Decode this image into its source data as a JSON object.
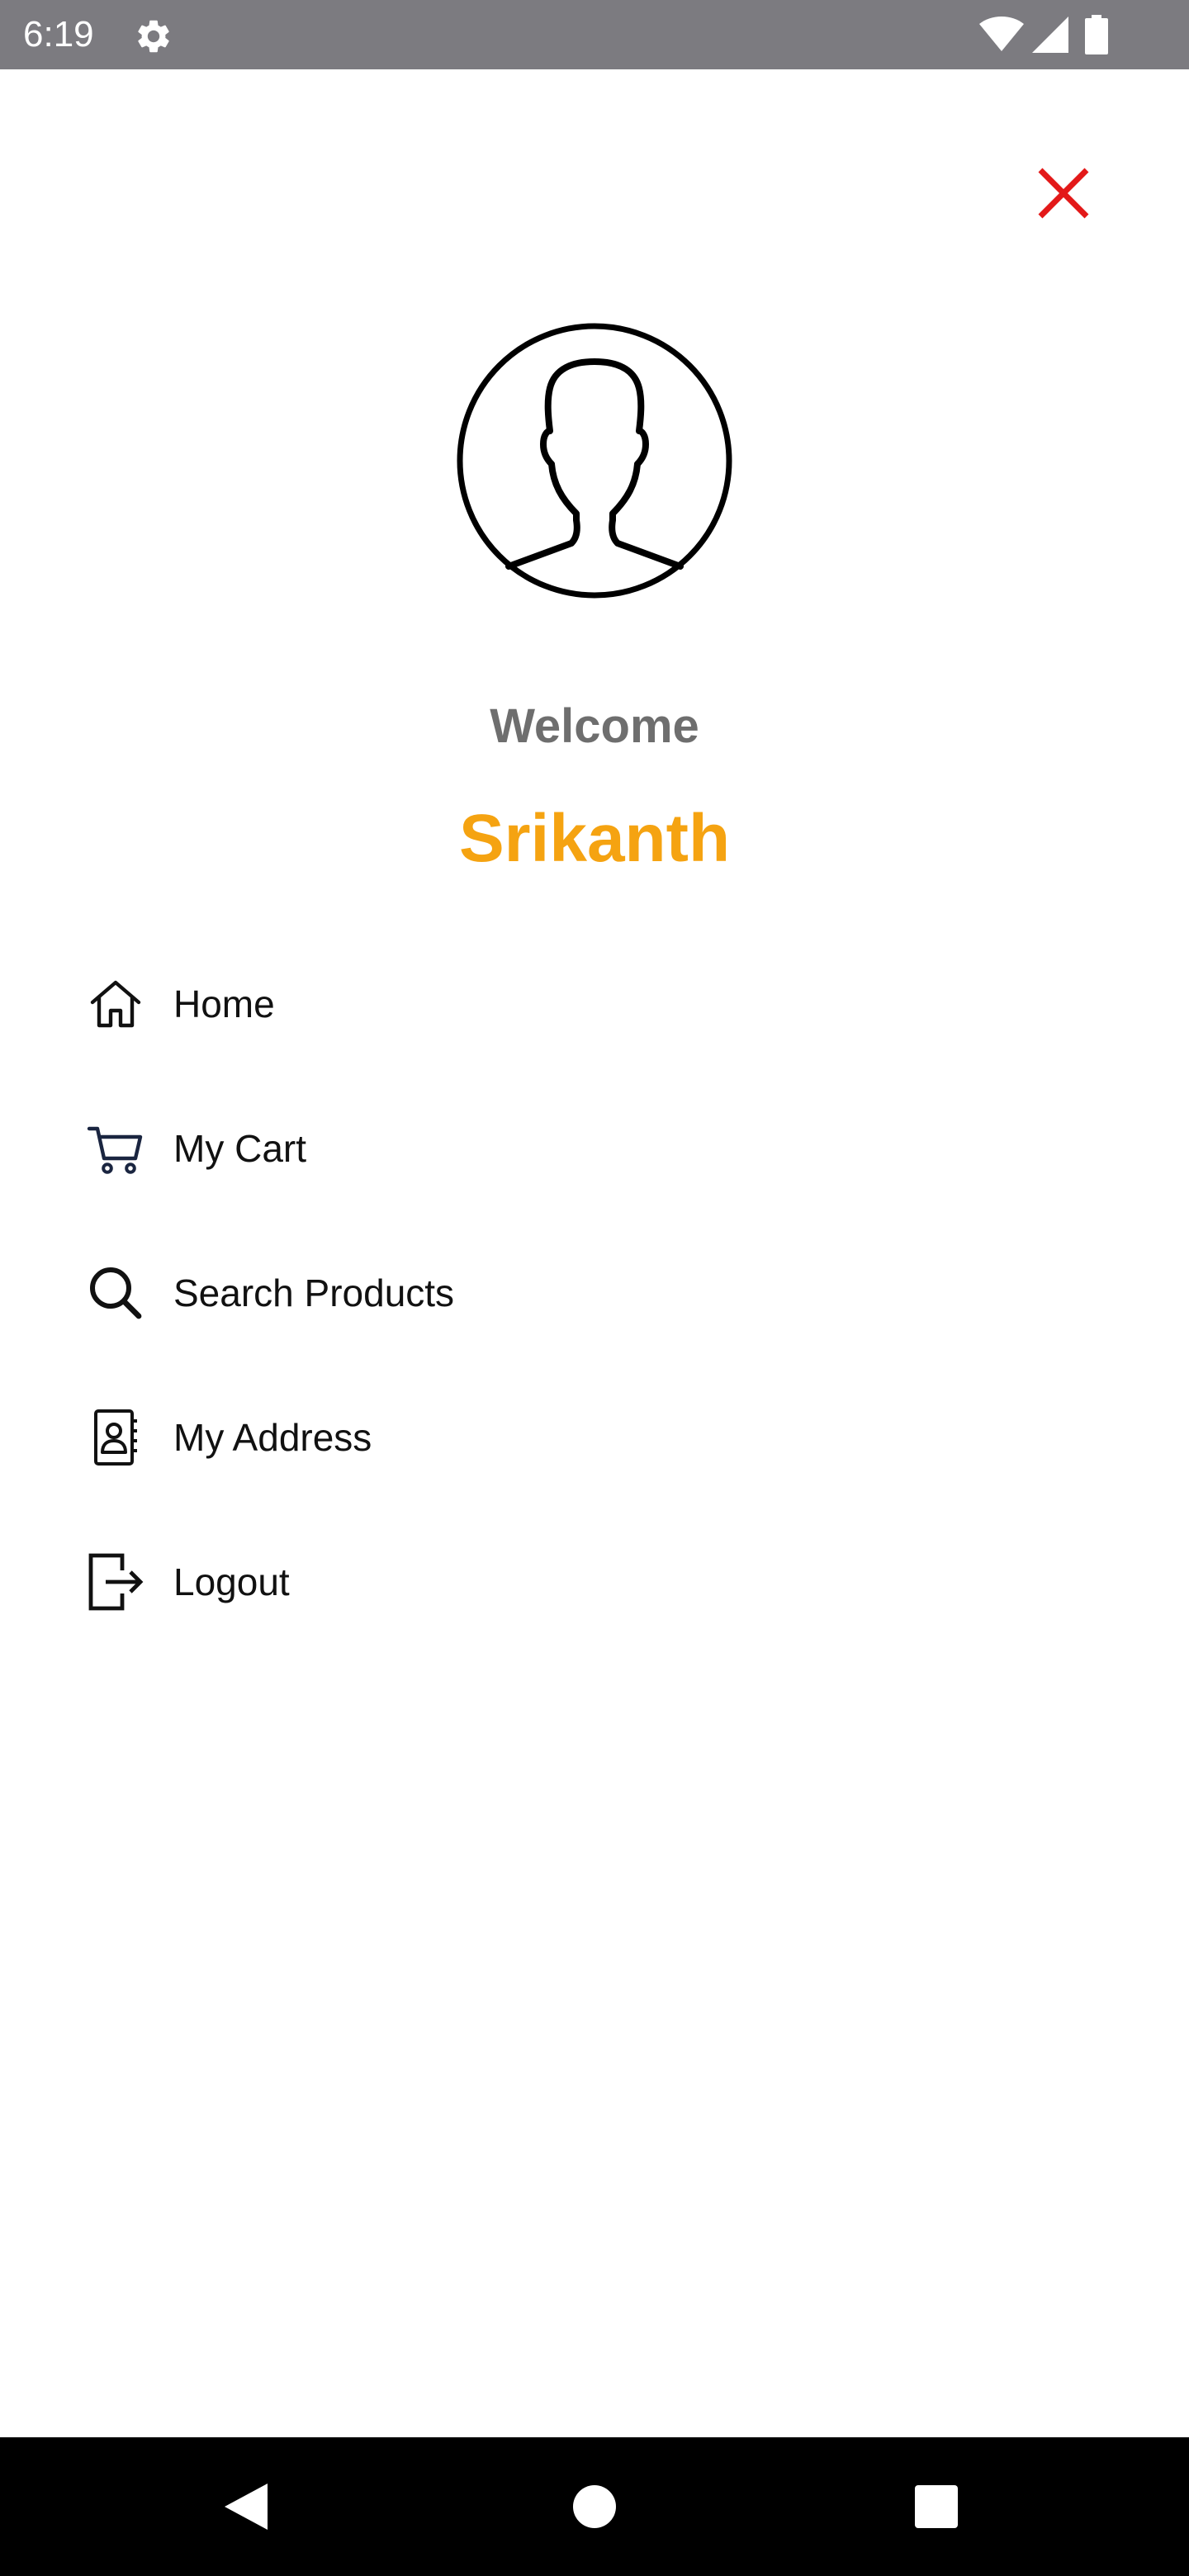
{
  "status_bar": {
    "time": "6:19",
    "icons": [
      "gear-icon",
      "wifi-icon",
      "signal-icon",
      "battery-icon"
    ],
    "background": "#7c7b80"
  },
  "header": {
    "close_icon": "close-icon",
    "close_color": "#e31919"
  },
  "profile": {
    "avatar_icon": "user-avatar-icon",
    "welcome_text": "Welcome",
    "username": "Srikanth",
    "username_color": "#f5a311"
  },
  "menu": {
    "items": [
      {
        "label": "Home",
        "icon": "home-icon"
      },
      {
        "label": "My Cart",
        "icon": "cart-icon"
      },
      {
        "label": "Search Products",
        "icon": "search-icon"
      },
      {
        "label": "My Address",
        "icon": "address-book-icon"
      },
      {
        "label": "Logout",
        "icon": "logout-icon"
      }
    ]
  },
  "nav_bar": {
    "icons": [
      "back-icon",
      "home-circle-icon",
      "recents-icon"
    ]
  }
}
